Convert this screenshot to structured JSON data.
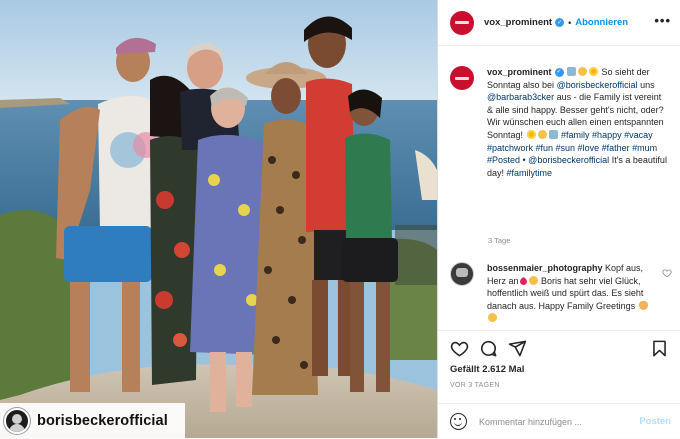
{
  "photo": {
    "alt": "Family photo",
    "watermark_name": "borisbeckerofficial"
  },
  "header": {
    "username": "vox_prominent",
    "separator": "•",
    "follow_label": "Abonnieren",
    "more_label": "•••"
  },
  "caption": {
    "username": "vox_prominent",
    "pre1": "So sieht der Sonntag also bei ",
    "mention1": "@borisbeckerofficial",
    "pre2": " uns ",
    "mention2": "@barbarab3cker",
    "body": " aus - die Family ist vereint & alle sind happy. Besser geht's nicht, oder? Wir wünschen euch allen einen entspannten Sonntag! ",
    "hashtags": "#family #happy #vacay #patchwork #fun #sun #love #father #mum #Posted • @borisbeckerofficial",
    "tail": " It's a beautiful day! ",
    "last_tag": "#familytime",
    "age": "3 Tage"
  },
  "comment": {
    "username": "bossenmaier_photography",
    "text_a": " Kopf aus, Herz an",
    "text_b": " Boris hat sehr viel Glück, hoffentlich weiß und spürt das. Es sieht danach aus. Happy Family Greetings ",
    "like_icon": "heart-outline-icon"
  },
  "actions": {
    "likes": "Gefällt 2.612 Mal",
    "time": "VOR 3 TAGEN",
    "comment_placeholder": "Kommentar hinzufügen ...",
    "post_label": "Posten"
  },
  "colors": {
    "brand_red": "#c8102e",
    "link_blue": "#0095f6",
    "tag_blue": "#00376b",
    "muted": "#8e8e8e"
  }
}
